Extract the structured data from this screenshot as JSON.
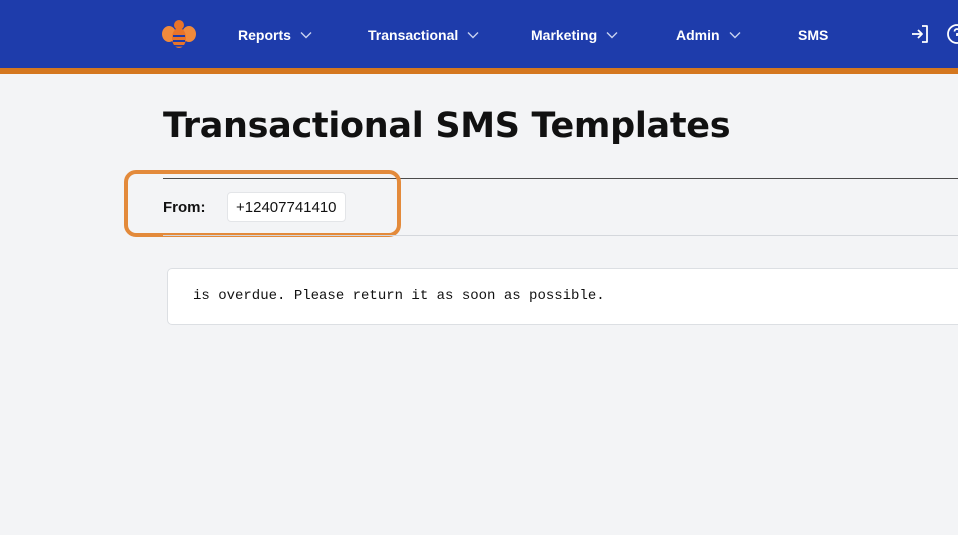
{
  "header": {
    "nav": [
      {
        "label": "Reports",
        "has_dropdown": true
      },
      {
        "label": "Transactional",
        "has_dropdown": true
      },
      {
        "label": "Marketing",
        "has_dropdown": true
      },
      {
        "label": "Admin",
        "has_dropdown": true
      },
      {
        "label": "SMS",
        "has_dropdown": false
      }
    ],
    "icons": [
      "bee-logo-icon",
      "chevron-down-icon",
      "sign-out-icon",
      "help-icon"
    ]
  },
  "page": {
    "title": "Transactional SMS Templates"
  },
  "from": {
    "label": "From:",
    "value": "+12407741410"
  },
  "templates": [
    {
      "text": "is overdue. Please return it as soon as possible."
    }
  ],
  "colors": {
    "header_bg": "#1e3cab",
    "header_accent": "#d4771f",
    "highlight": "#e38a3b",
    "page_bg": "#f3f4f6"
  }
}
